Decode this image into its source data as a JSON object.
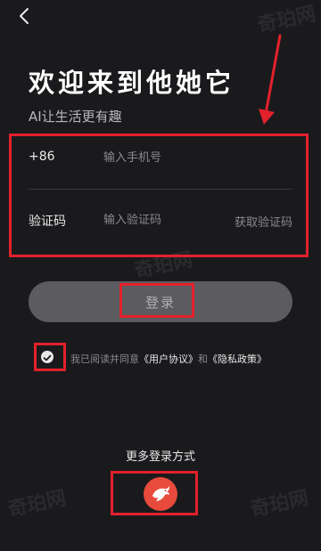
{
  "header": {
    "title": "欢迎来到他她它",
    "subtitle": "AI让生活更有趣"
  },
  "form": {
    "country_code": "+86",
    "phone_placeholder": "输入手机号",
    "code_label": "验证码",
    "code_placeholder": "输入验证码",
    "get_code_label": "获取验证码"
  },
  "login_button_label": "登录",
  "agreement": {
    "checked": true,
    "prefix": "我已阅读并同意",
    "user_agreement": "《用户协议》",
    "conjunction": "和",
    "privacy_policy": "《隐私政策》"
  },
  "more_login": {
    "label": "更多登录方式",
    "provider_icon": "red-bird-logo-icon"
  },
  "watermark_text": "奇珀网",
  "colors": {
    "background": "#1a1a1d",
    "button_disabled": "#5b5b60",
    "annotation_red": "#e3212b",
    "provider_red": "#e84a3c"
  }
}
